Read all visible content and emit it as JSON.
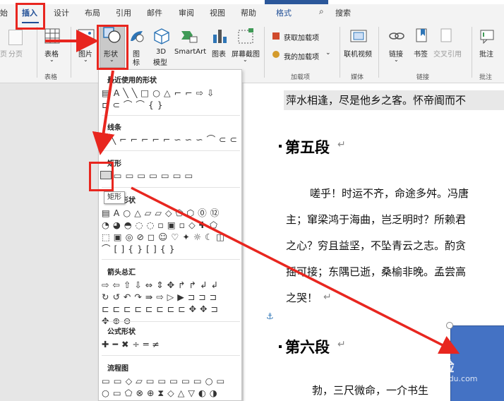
{
  "tabs": {
    "start": "始",
    "insert": "插入",
    "design": "设计",
    "layout": "布局",
    "references": "引用",
    "mailings": "邮件",
    "review": "审阅",
    "view": "视图",
    "help": "帮助",
    "format": "格式",
    "search": "搜索"
  },
  "ribbon": {
    "page_break": "分页",
    "table": "表格",
    "table_group": "表格",
    "picture": "图片",
    "shapes": "形状",
    "icons_a": "图",
    "icons_b": "标",
    "model3d_a": "3D",
    "model3d_b": "模型",
    "smartart": "SmartArt",
    "chart": "图表",
    "screenshot": "屏幕截图",
    "get_addins": "获取加载项",
    "my_addins": "我的加载项",
    "addins_group": "加载项",
    "online_video": "联机视频",
    "media_group": "媒体",
    "link": "链接",
    "bookmark": "书签",
    "cross_ref": "交叉引用",
    "links_group": "链接",
    "comment": "批注",
    "comment_group": "批注"
  },
  "dropdown": {
    "recent": "最近使用的形状",
    "lines": "线条",
    "rect": "矩形",
    "basic": "基本形状",
    "arrows": "箭头总汇",
    "equation": "公式形状",
    "flowchart": "流程图",
    "tooltip": "矩形",
    "rows": {
      "recent_1": "▤ A ╲ ╲ □ ○ △ ⌐ ⌐ ⇨ ⇩",
      "recent_2": "⊏ ⊂ ⌒ ⌒ { }",
      "lines_1": "╲ ╲ ⌐ ⌐ ⌐ ⌐ ⌐ ∽ ∽ ∽ ⌒ ⊂ ⊂",
      "rect_1": "▭ ▭ ▭ ▭ ▭ ▭ ▭ ▭",
      "basic_1": "▤ A ○ △ ▱ ▱ ◇ ⬠ ⬡ ⓪ ⑫",
      "basic_2": "◔ ◕ ◓ ◌ ◌ ▫ ▣ ▫ ◇ ✚ ⬠",
      "basic_3": "⬚ ▣ ◎ ⊘ ◻ ☺ ♡ ✦ ☼ ☾ ◫",
      "basic_4": "⌒ [ ] { } [ ] { }",
      "arrows_1": "⇨ ⇦ ⇧ ⇩ ⇔ ⇕ ✥ ↱ ↱ ↲ ↲",
      "arrows_2": "↻ ↺ ↶ ↷ ⇛ ⇨ ▷ ▶ ⊐ ⊐ ⊐",
      "arrows_3": "⊏ ⊏ ⊏ ⊏ ⊏ ⊏ ⊏ ⊏ ✥ ✥ ⊐",
      "arrows_4": "✥ ⊕ ⊖",
      "equation_1": "✚ ━ ✖ ÷ ═ ≠",
      "flow_1": "▭ ▭ ◇ ▱ ▭ ▭ ▭ ▭ ▭ ○ ▭",
      "flow_2": "○ ▭ ⬠ ⊗ ⊕ ⧗ ◇ △ ▽ ◐ ◑"
    }
  },
  "doc": {
    "line_top": "萍水相逢，尽是他乡之客。怀帝阍而不",
    "heading5": "第五段",
    "p1": "嗟乎！时运不齐，命途多舛。冯唐",
    "p2": "主；窜梁鸿于海曲，岂乏明时？所赖君",
    "p3": "之心？穷且益坚，不坠青云之志。酌贪",
    "p4": "摇可接；东隅已逝，桑榆非晚。孟尝高",
    "p5": "之哭！",
    "heading6": "第六段",
    "p6": "勃，三尺微命，一介书生",
    "return_mark": "↵"
  },
  "watermark": {
    "brand": "Bai 经验",
    "url": "jingyan.baidu.com"
  },
  "colors": {
    "ribbon_bg": "#f3f3f3",
    "accent": "#1f4e96",
    "annotation_red": "#e8261f",
    "shape_fill": "#4472c4"
  }
}
